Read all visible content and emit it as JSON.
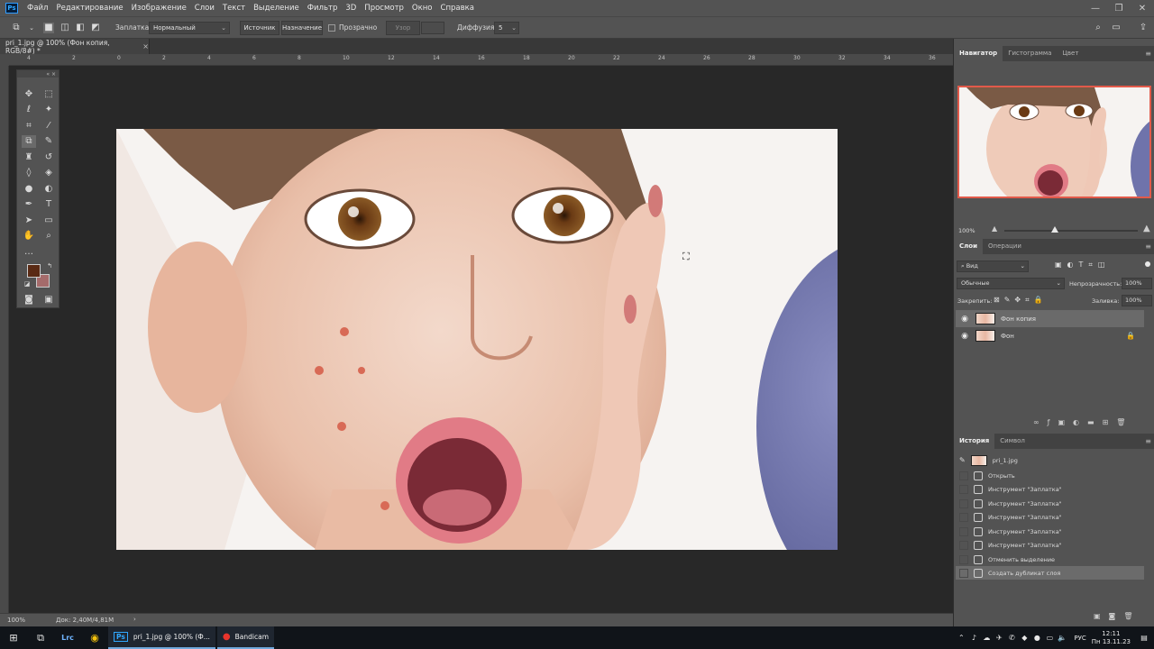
{
  "app": {
    "logo": "Ps"
  },
  "menu": [
    "Файл",
    "Редактирование",
    "Изображение",
    "Слои",
    "Текст",
    "Выделение",
    "Фильтр",
    "3D",
    "Просмотр",
    "Окно",
    "Справка"
  ],
  "window_controls": {
    "minimize": "—",
    "restore": "❐",
    "close": "✕"
  },
  "options": {
    "patch_label": "Заплатка:",
    "patch_mode": "Нормальный",
    "source_btn": "Источник",
    "destination_btn": "Назначение",
    "transparent_label": "Прозрачно",
    "pattern_btn": "Узор",
    "diffusion_label": "Диффузия:",
    "diffusion_value": "5"
  },
  "document": {
    "tab_title": "pri_1.jpg @ 100% (Фон копия, RGB/8#) *",
    "close": "×"
  },
  "ruler": {
    "top_ticks": [
      "4",
      "2",
      "0",
      "2",
      "4",
      "6",
      "8",
      "10",
      "12",
      "14",
      "16",
      "18",
      "20",
      "22",
      "24",
      "26",
      "28",
      "30",
      "32",
      "34",
      "36"
    ]
  },
  "status": {
    "zoom": "100%",
    "doc_size": "Док: 2,40M/4,81M",
    "arrow": "›"
  },
  "navigator": {
    "tabs": [
      "Навигатор",
      "Гистограмма",
      "Цвет"
    ],
    "zoom": "100%",
    "slider_value": 0.38
  },
  "layers_panel": {
    "tabs": [
      "Слои",
      "Операции"
    ],
    "search": "Вид",
    "blend_mode": "Обычные",
    "opacity_label": "Непрозрачность:",
    "opacity_value": "100%",
    "lock_label": "Закрепить:",
    "fill_label": "Заливка:",
    "fill_value": "100%",
    "layers": [
      {
        "name": "Фон копия",
        "selected": true,
        "locked": false
      },
      {
        "name": "Фон",
        "selected": false,
        "locked": true
      }
    ]
  },
  "history_panel": {
    "tabs": [
      "История",
      "Символ"
    ],
    "snapshot": "pri_1.jpg",
    "items": [
      "Открыть",
      "Инструмент \"Заплатка\"",
      "Инструмент \"Заплатка\"",
      "Инструмент \"Заплатка\"",
      "Инструмент \"Заплатка\"",
      "Инструмент \"Заплатка\"",
      "Отменить выделение",
      "Создать дубликат слоя"
    ],
    "selected_index": 7
  },
  "taskbar": {
    "apps": [
      {
        "label": "pri_1.jpg @ 100% (Ф...",
        "icon": "Ps"
      },
      {
        "label": "Bandicam",
        "icon": "●"
      }
    ],
    "lang": "РУС",
    "time": "12:11",
    "date": "Пн 13.11.23"
  },
  "colors": {
    "foreground": "#5a2a14",
    "background": "#a56b6b",
    "accent": "#31a8ff"
  }
}
